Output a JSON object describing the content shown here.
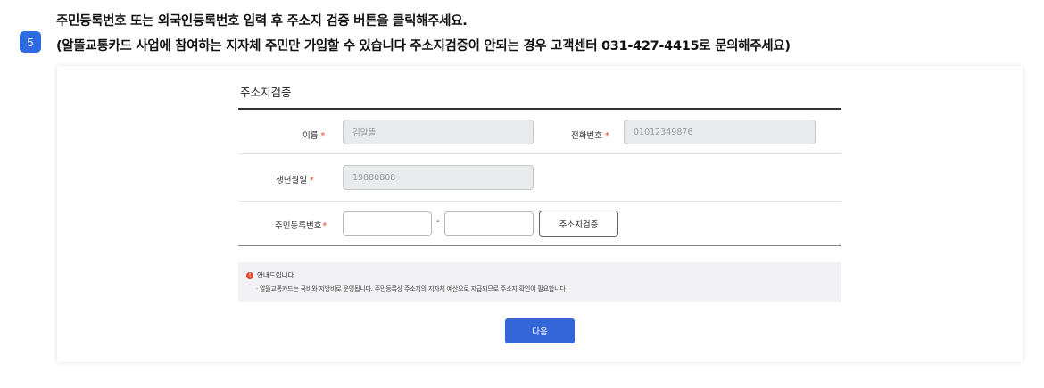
{
  "step": {
    "number": "5"
  },
  "instructions": {
    "line1": "주민등록번호 또는 외국인등록번호 입력 후 주소지 검증 버튼을 클릭해주세요.",
    "line2": "(알뜰교통카드 사업에 참여하는 지자체 주민만 가입할 수 있습니다 주소지검증이 안되는 경우 고객센터 031-427-4415로 문의해주세요)"
  },
  "form": {
    "title": "주소지검증",
    "required_mark": "*",
    "name": {
      "label": "이름",
      "value": "김알뜰"
    },
    "phone": {
      "label": "전화번호",
      "value": "01012349876"
    },
    "birth": {
      "label": "생년월일",
      "value": "19880808"
    },
    "rrn": {
      "label": "주민등록번호",
      "front": "",
      "separator": "-",
      "back": ""
    },
    "verify_button": "주소지검증"
  },
  "notice": {
    "icon": "warning-icon",
    "title": "안내드립니다",
    "text": "· 알뜰교통카드는 국비와 지방비로 운영됩니다. 주민등록상 주소지의 지자체 예산으로 지급되므로 주소지 확인이 필요합니다"
  },
  "next_button": "다음",
  "colors": {
    "accent": "#3566d8",
    "required": "#e0452b",
    "badge": "#2f6be0"
  }
}
